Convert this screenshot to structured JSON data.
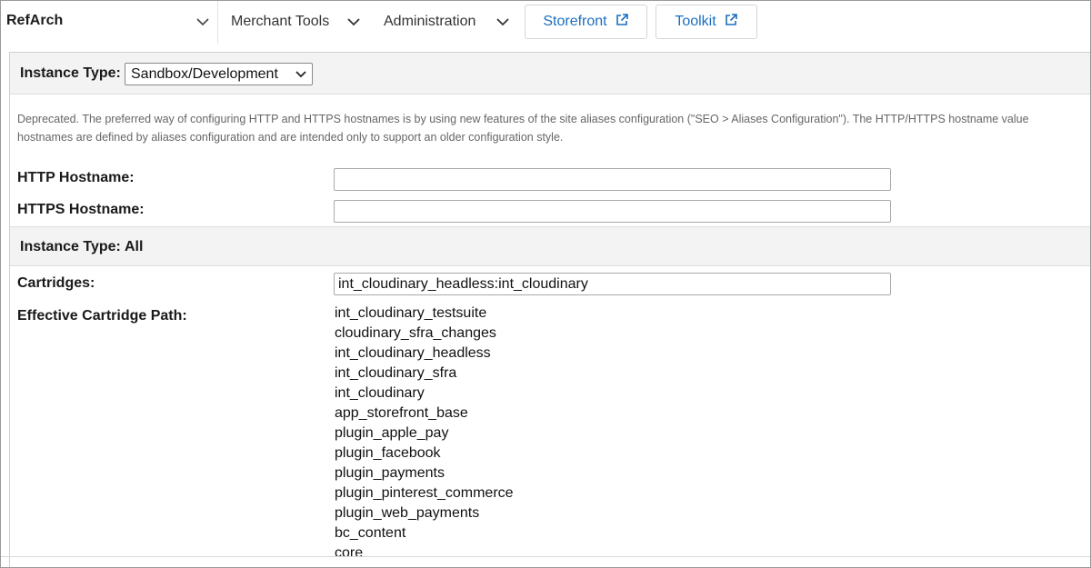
{
  "nav": {
    "brand": "RefArch",
    "items": [
      {
        "label": "Merchant Tools"
      },
      {
        "label": "Administration"
      }
    ],
    "buttons": [
      {
        "label": "Storefront"
      },
      {
        "label": "Toolkit"
      }
    ]
  },
  "section_sandbox": {
    "instance_type_label": "Instance Type:",
    "instance_type_value": "Sandbox/Development"
  },
  "description": {
    "line1": "Deprecated. The preferred way of configuring HTTP and HTTPS hostnames is by using new features of the site aliases configuration (\"SEO > Aliases Configuration\"). The HTTP/HTTPS hostname value",
    "line2": "hostnames are defined by aliases configuration and are intended only to support an older configuration style."
  },
  "fields": {
    "http_label": "HTTP Hostname:",
    "http_value": "",
    "https_label": "HTTPS Hostname:",
    "https_value": ""
  },
  "section_all": {
    "instance_type_label": "Instance Type:",
    "instance_type_value": "All"
  },
  "cartridges": {
    "label": "Cartridges:",
    "value": "int_cloudinary_headless:int_cloudinary",
    "effective_label": "Effective Cartridge Path:",
    "effective_path": [
      "int_cloudinary_testsuite",
      "cloudinary_sfra_changes",
      "int_cloudinary_headless",
      "int_cloudinary_sfra",
      "int_cloudinary",
      "app_storefront_base",
      "plugin_apple_pay",
      "plugin_facebook",
      "plugin_payments",
      "plugin_pinterest_commerce",
      "plugin_web_payments",
      "bc_content",
      "core"
    ]
  },
  "colors": {
    "accent_link": "#1b6fc0",
    "band_background": "#f3f3f3",
    "description_text": "#666666"
  },
  "icons": [
    "chevron-down-icon",
    "external-link-icon"
  ]
}
